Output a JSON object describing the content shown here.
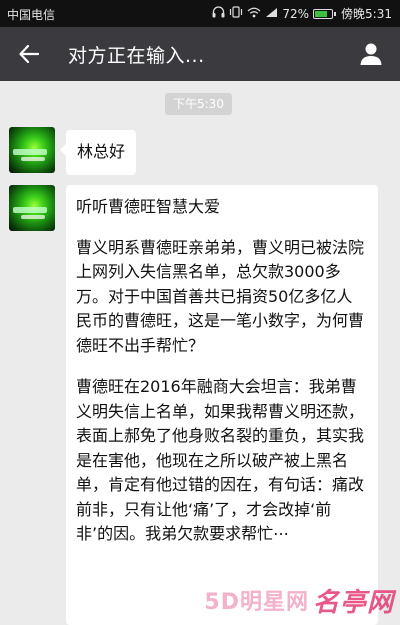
{
  "status_bar": {
    "carrier": "中国电信",
    "battery": "72%",
    "battery_level": 0.72,
    "time": "傍晚5:31",
    "icons": [
      "headphones-icon",
      "vibrate-icon",
      "wifi-icon",
      "signal-icon",
      "battery-icon"
    ]
  },
  "header": {
    "title": "对方正在输入...",
    "back_icon": "back-arrow-icon",
    "profile_icon": "person-icon"
  },
  "chat": {
    "timestamp": "下午5:30",
    "messages": [
      {
        "text": "林总好"
      },
      {
        "paragraphs": [
          "听听曹德旺智慧大爱",
          "曹义明系曹德旺亲弟弟，曹义明已被法院上网列入失信黑名单，总欠款3000多万。对于中国首善共已捐资50亿多亿人民币的曹德旺，这是一笔小数字，为何曹德旺不出手帮忙？",
          "曹德旺在2016年融商大会坦言：我弟曹义明失信上名单，如果我帮曹义明还款，表面上郝免了他身败名裂的重负，其实我是在害他，他现在之所以破产被上黑名单，肯定有他过错的因在，有句话：痛改前非，只有让他‘痛’了，才会改掉‘前非’的因。我弟欠款要求帮忙⋯"
        ]
      }
    ]
  },
  "watermark": {
    "part1": "5D明星网",
    "part2": "名亭网"
  }
}
